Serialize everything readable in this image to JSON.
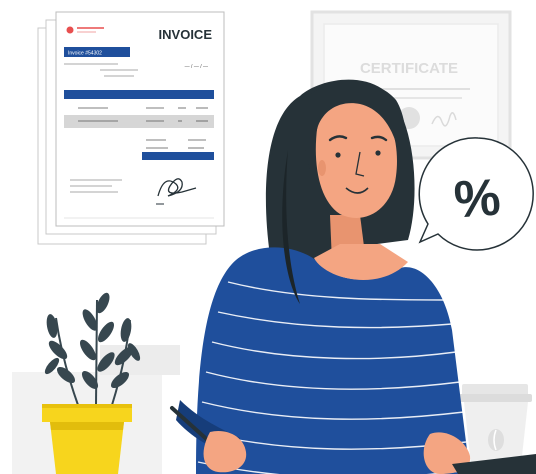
{
  "invoice": {
    "title": "INVOICE",
    "number_label": "Invoice #54302",
    "date_placeholder": "— / — / —"
  },
  "certificate": {
    "title": "CERTIFICATE"
  },
  "speech_bubble": {
    "symbol": "%"
  },
  "colors": {
    "brand_blue": "#1f4f9c",
    "skin": "#f4a582",
    "hair": "#263238",
    "pot_yellow": "#f7d51d",
    "leaf": "#37474f",
    "bubble_border": "#263238",
    "paper_border": "#c7c7c7",
    "bg_gray": "#f2f2f2"
  },
  "icons": {
    "signature": "signature-scribble-icon",
    "coffee_bean": "coffee-bean-icon",
    "seal": "certificate-seal-icon"
  }
}
